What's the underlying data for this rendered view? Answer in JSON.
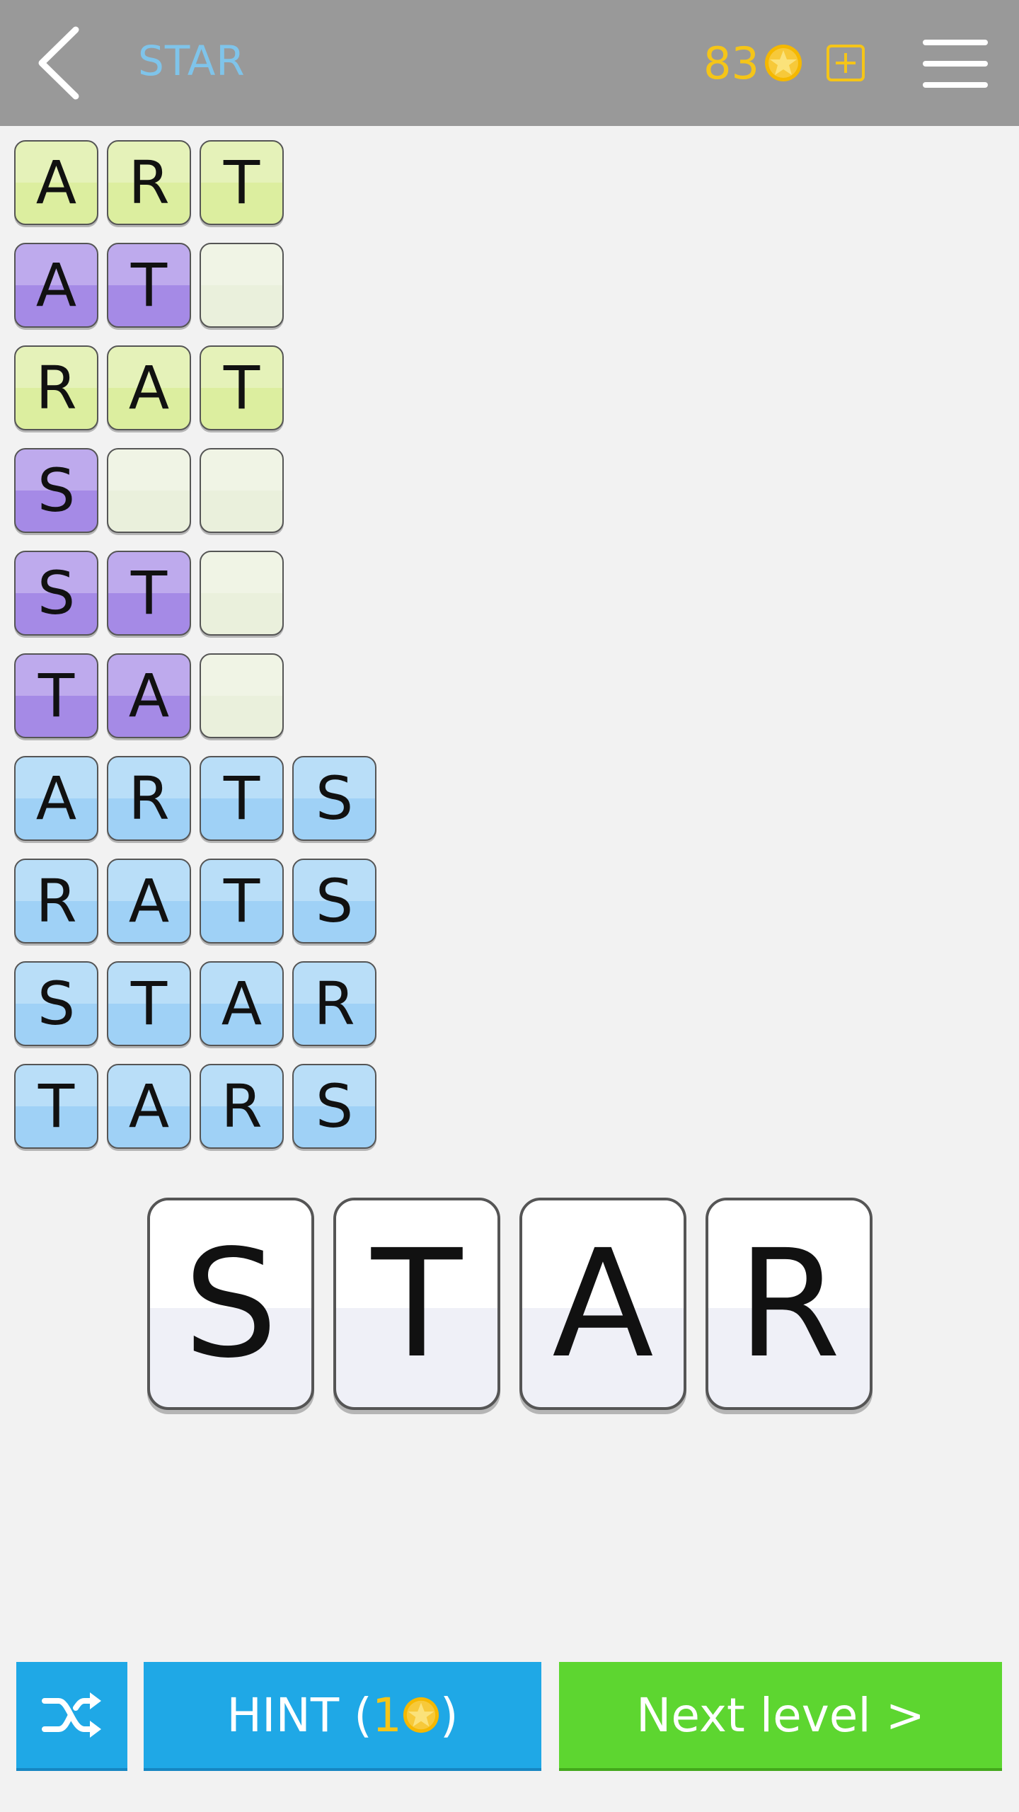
{
  "header": {
    "title": "STAR",
    "coins": "83",
    "icons": {
      "back": "chevron-left-icon",
      "coin": "star-coin-icon",
      "add": "plus-box-icon",
      "menu": "hamburger-menu-icon"
    }
  },
  "words": [
    {
      "letters": [
        "A",
        "R",
        "T"
      ],
      "color": "green"
    },
    {
      "letters": [
        "A",
        "T",
        ""
      ],
      "color": "purple"
    },
    {
      "letters": [
        "R",
        "A",
        "T"
      ],
      "color": "green"
    },
    {
      "letters": [
        "S",
        "",
        ""
      ],
      "color": "purple"
    },
    {
      "letters": [
        "S",
        "T",
        ""
      ],
      "color": "purple"
    },
    {
      "letters": [
        "T",
        "A",
        ""
      ],
      "color": "purple"
    },
    {
      "letters": [
        "A",
        "R",
        "T",
        "S"
      ],
      "color": "blue"
    },
    {
      "letters": [
        "R",
        "A",
        "T",
        "S"
      ],
      "color": "blue"
    },
    {
      "letters": [
        "S",
        "T",
        "A",
        "R"
      ],
      "color": "blue"
    },
    {
      "letters": [
        "T",
        "A",
        "R",
        "S"
      ],
      "color": "blue"
    }
  ],
  "pool": [
    "S",
    "T",
    "A",
    "R"
  ],
  "buttons": {
    "hint_label": "HINT (",
    "hint_cost": "1",
    "hint_close": ")",
    "next_label": "Next level >"
  },
  "colors": {
    "header": "#999999",
    "title": "#7fc4ea",
    "coins": "#f5c518",
    "tile_green": "#dcee9f",
    "tile_purple": "#a58ae6",
    "tile_blue": "#9fd1f6",
    "tile_empty": "#eaf0dc",
    "button_blue": "#1fa8e6",
    "button_green": "#5dd630"
  }
}
